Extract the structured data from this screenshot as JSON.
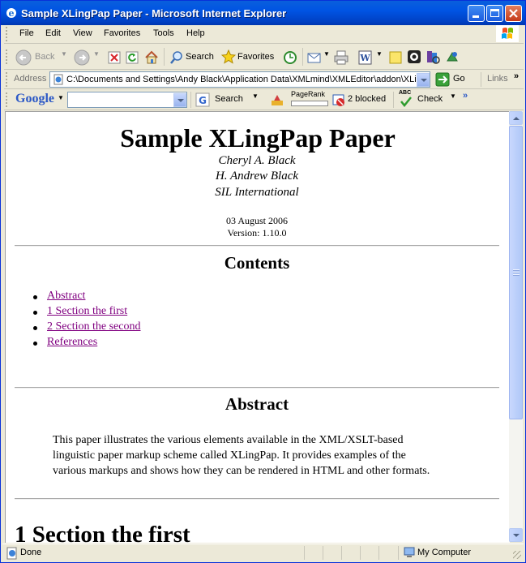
{
  "window": {
    "title": "Sample XLingPap Paper - Microsoft Internet Explorer"
  },
  "menu": [
    "File",
    "Edit",
    "View",
    "Favorites",
    "Tools",
    "Help"
  ],
  "toolbar": {
    "back": "Back",
    "search": "Search",
    "favorites": "Favorites"
  },
  "address": {
    "label": "Address",
    "url": "C:\\Documents and Settings\\Andy Black\\Application Data\\XMLmind\\XMLEditor\\addon\\XLingPap\\",
    "go": "Go",
    "links": "Links"
  },
  "googlebar": {
    "logo": "Google",
    "search": "Search",
    "pagerank": "PageRank",
    "blocked": "2 blocked",
    "check": "Check",
    "abc": "ABC"
  },
  "doc": {
    "title": "Sample XLingPap Paper",
    "authors": [
      "Cheryl A. Black",
      "H. Andrew Black",
      "SIL International"
    ],
    "date": "03 August 2006",
    "version": "Version: 1.10.0",
    "contents_heading": "Contents",
    "toc": [
      "Abstract",
      "1 Section the first",
      "2 Section the second",
      "References"
    ],
    "abstract_heading": "Abstract",
    "abstract_lines": [
      "This paper illustrates the various elements available in the XML/XSLT-based",
      "linguistic paper markup scheme called XLingPap. It provides examples of the",
      "various markups and shows how they can be rendered in HTML and other formats."
    ],
    "section1_heading": "1 Section the first"
  },
  "status": {
    "left": "Done",
    "zone": "My Computer"
  }
}
